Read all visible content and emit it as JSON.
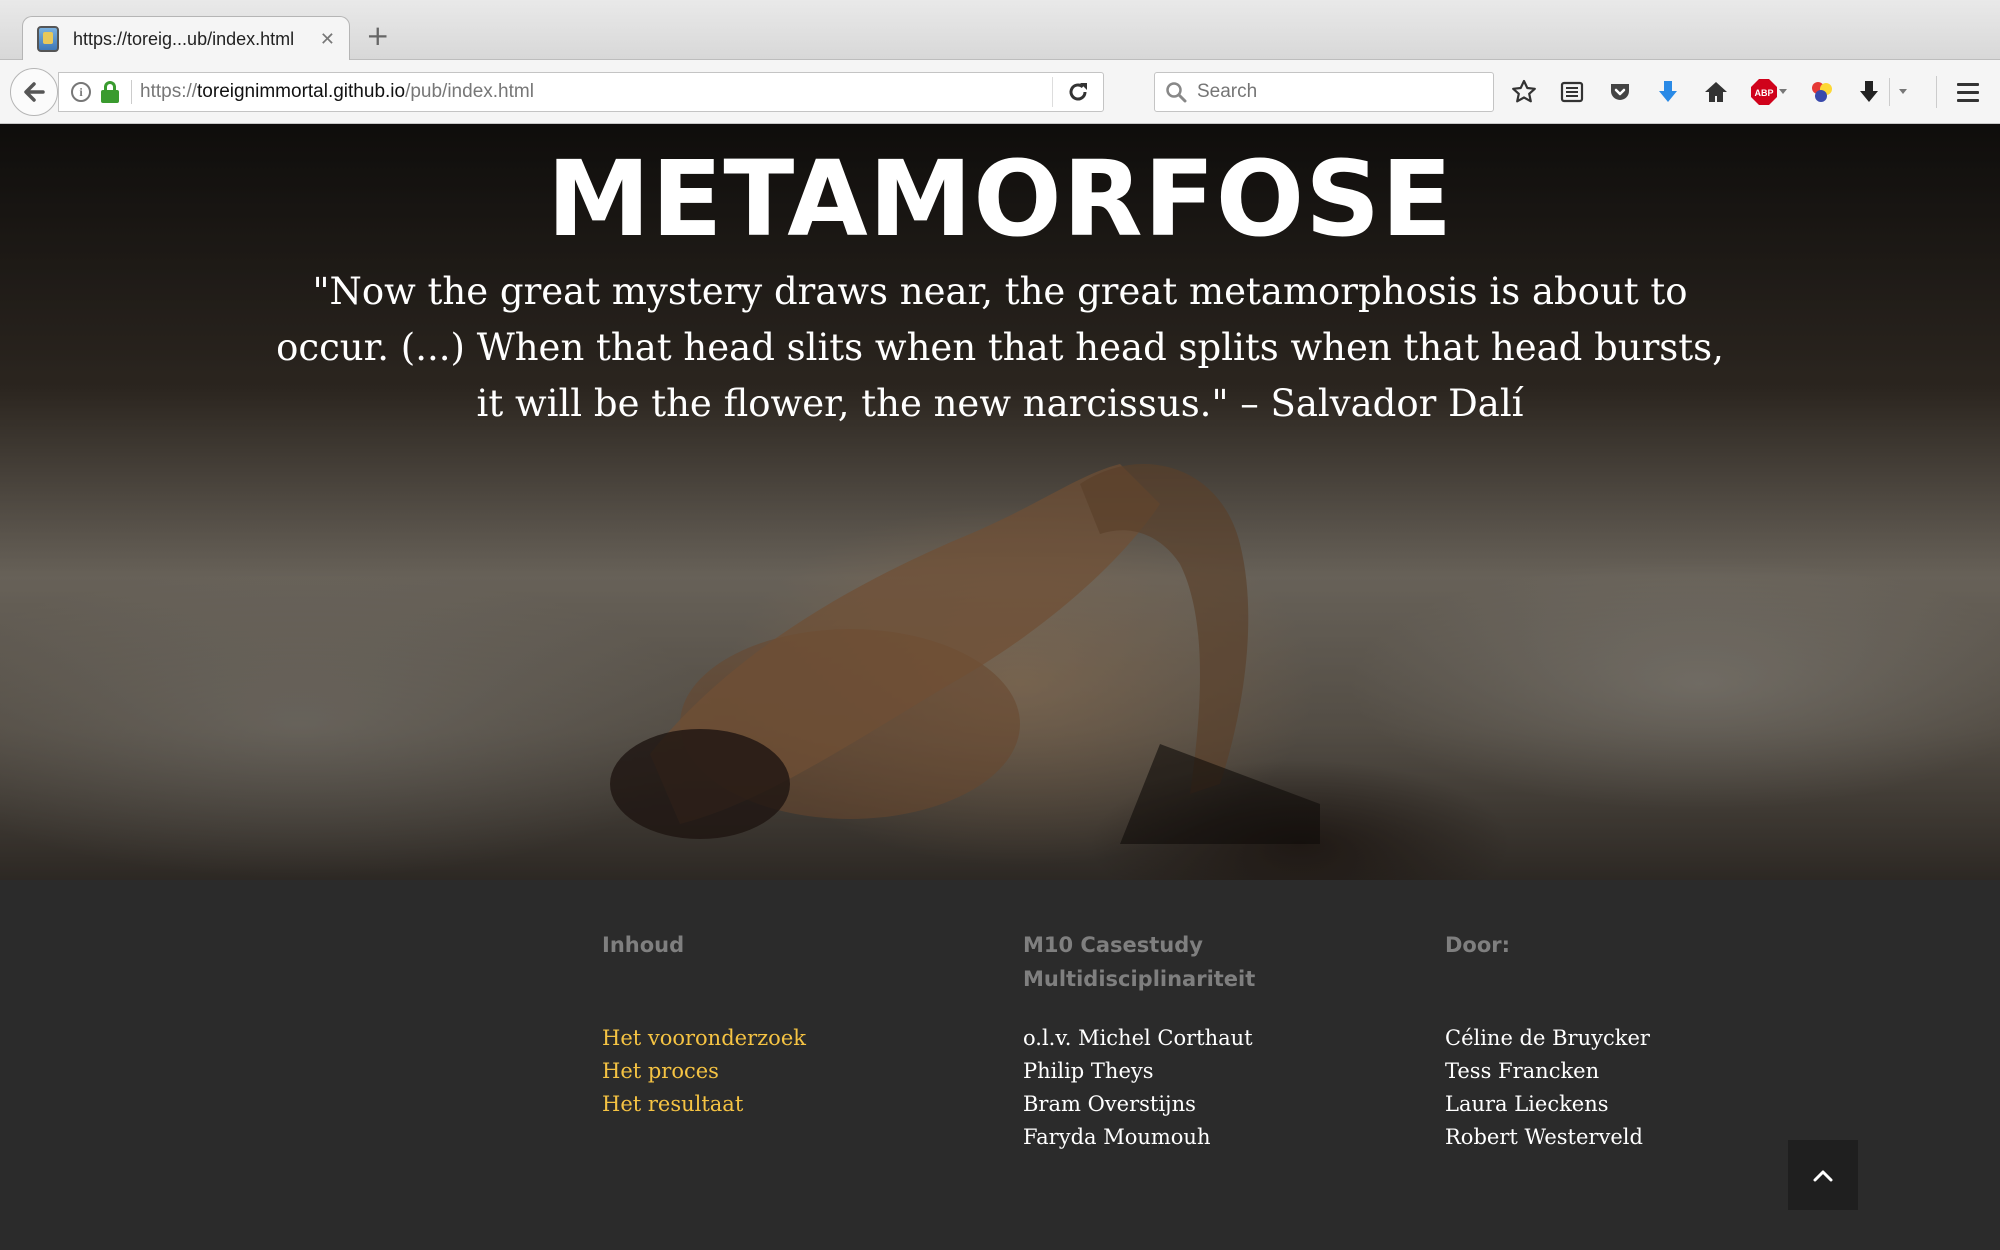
{
  "browser": {
    "tab_title": "https://toreig...ub/index.html",
    "tab_close": "✕",
    "new_tab": "+",
    "url_scheme": "https://",
    "url_host": "toreignimmortal.github.io",
    "url_path": "/pub/index.html",
    "search_placeholder": "Search",
    "info_glyph": "i",
    "abp_label": "ABP"
  },
  "hero": {
    "title": "METAMORFOSE",
    "quote": "\"Now the great mystery draws near, the great metamorphosis is about to occur. (...) When that head slits when that head splits when that head bursts, it will be the flower, the new narcissus.\" – Salvador Dalí"
  },
  "footer": {
    "col1": {
      "heading": "Inhoud",
      "links": [
        "Het vooronderzoek",
        "Het proces",
        "Het resultaat"
      ]
    },
    "col2": {
      "heading": "M10 Casestudy Multidisciplinariteit",
      "items": [
        "o.l.v. Michel Corthaut",
        "Philip Theys",
        "Bram Overstijns",
        "Faryda Moumouh"
      ]
    },
    "col3": {
      "heading": "Door:",
      "items": [
        "Céline de Bruycker",
        "Tess Francken",
        "Laura Lieckens",
        "Robert Westerveld"
      ]
    }
  },
  "colors": {
    "link": "#f5c343",
    "footer_bg": "#2b2b2b",
    "heading": "#7f7f7f",
    "lock": "#3a9b2f",
    "download_blue": "#2a8ae6",
    "abp_red": "#d0021b"
  },
  "icons": [
    "back-arrow-icon",
    "info-icon",
    "lock-icon",
    "reload-icon",
    "search-icon",
    "bookmark-star-icon",
    "reading-list-icon",
    "pocket-icon",
    "download-blue-icon",
    "home-icon",
    "adblock-icon",
    "colorful-extension-icon",
    "download-icon",
    "hamburger-menu-icon",
    "chevron-up-icon"
  ]
}
